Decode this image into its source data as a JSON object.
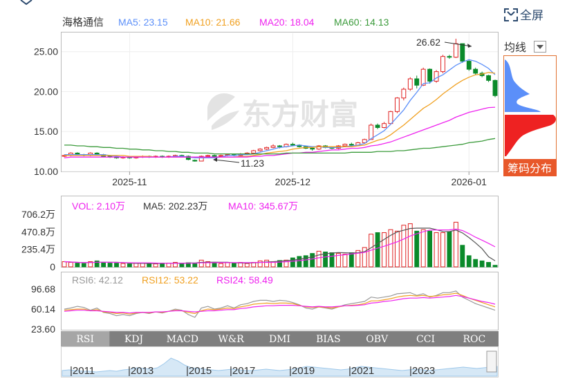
{
  "legend_main": {
    "name": "海格通信",
    "ma5": "MA5: 23.15",
    "ma10": "MA10: 21.66",
    "ma20": "MA20: 18.04",
    "ma60": "MA60: 14.13"
  },
  "legend_vol": {
    "vol": "VOL: 2.10万",
    "ma5": "MA5: 202.23万",
    "ma10": "MA10: 345.67万"
  },
  "legend_rsi": {
    "rsi6": "RSI6: 42.12",
    "rsi12": "RSI12: 53.22",
    "rsi24": "RSI24: 58.49"
  },
  "fullscreen_label": "全屏",
  "junxian_label": "均线",
  "chip_button_label": "筹码分布",
  "watermark": "东方财富",
  "high_annotation": "26.62",
  "low_annotation": "11.23",
  "tabs": [
    "RSI",
    "KDJ",
    "MACD",
    "W&R",
    "DMI",
    "BIAS",
    "OBV",
    "CCI",
    "ROC"
  ],
  "active_tab": "RSI",
  "timeline_labels": [
    "2011",
    "2013",
    "2015",
    "2017",
    "2019",
    "2021",
    "2023"
  ],
  "colors": {
    "up": "#e02020",
    "down": "#0a8a2a",
    "ma5": "#5b8ff9",
    "ma10": "#f0a020",
    "ma20": "#ee22ee",
    "ma60": "#3a9a3a",
    "vol_ma5": "#555555",
    "vol_ma10": "#ee22ee",
    "rsi6": "#999999",
    "rsi12": "#f0a020",
    "rsi24": "#ee22ee"
  },
  "chart_data": [
    {
      "type": "candlestick",
      "title": "",
      "x_tick_labels": [
        "2025-11",
        "2025-12",
        "2026-01"
      ],
      "y_tick_labels": [
        "25.00",
        "20.00",
        "15.00",
        "10.00"
      ],
      "ylim": [
        10,
        27.4
      ],
      "candles": [
        [
          11.9,
          12.0,
          12.1,
          11.8
        ],
        [
          12.0,
          12.3,
          12.4,
          11.9
        ],
        [
          12.3,
          12.1,
          12.4,
          12.0
        ],
        [
          12.1,
          12.0,
          12.2,
          11.9
        ],
        [
          12.0,
          12.3,
          12.4,
          11.9
        ],
        [
          12.3,
          12.1,
          12.4,
          12.0
        ],
        [
          12.1,
          11.9,
          12.2,
          11.8
        ],
        [
          11.9,
          11.8,
          12.0,
          11.7
        ],
        [
          11.8,
          11.7,
          11.9,
          11.6
        ],
        [
          11.7,
          11.8,
          11.9,
          11.6
        ],
        [
          11.8,
          11.7,
          11.9,
          11.6
        ],
        [
          11.7,
          11.8,
          11.9,
          11.6
        ],
        [
          11.8,
          11.9,
          12.0,
          11.7
        ],
        [
          11.9,
          11.8,
          12.0,
          11.7
        ],
        [
          11.8,
          11.9,
          12.0,
          11.7
        ],
        [
          11.9,
          11.8,
          12.0,
          11.7
        ],
        [
          11.8,
          11.9,
          12.0,
          11.7
        ],
        [
          11.9,
          12.0,
          12.1,
          11.8
        ],
        [
          12.0,
          11.9,
          12.1,
          11.8
        ],
        [
          11.9,
          11.5,
          12.0,
          11.4
        ],
        [
          11.4,
          11.3,
          11.5,
          11.23
        ],
        [
          11.3,
          11.9,
          12.0,
          11.3
        ],
        [
          11.9,
          12.0,
          12.1,
          11.8
        ],
        [
          12.0,
          11.9,
          12.1,
          11.8
        ],
        [
          11.9,
          12.0,
          12.1,
          11.8
        ],
        [
          12.0,
          12.1,
          12.2,
          11.9
        ],
        [
          12.1,
          12.0,
          12.2,
          11.9
        ],
        [
          12.0,
          12.2,
          12.3,
          11.9
        ],
        [
          12.2,
          12.3,
          12.4,
          12.1
        ],
        [
          12.3,
          12.6,
          12.7,
          12.2
        ],
        [
          12.6,
          12.8,
          12.9,
          12.5
        ],
        [
          12.8,
          13.0,
          13.1,
          12.7
        ],
        [
          13.0,
          13.2,
          13.4,
          12.9
        ],
        [
          13.2,
          13.1,
          13.3,
          12.9
        ],
        [
          13.1,
          13.4,
          13.5,
          13.0
        ],
        [
          13.4,
          13.3,
          13.6,
          13.2
        ],
        [
          13.3,
          13.1,
          13.4,
          13.0
        ],
        [
          13.1,
          12.9,
          13.2,
          12.8
        ],
        [
          12.9,
          12.8,
          13.0,
          12.6
        ],
        [
          12.8,
          13.2,
          13.3,
          12.7
        ],
        [
          13.2,
          13.0,
          13.3,
          12.9
        ],
        [
          13.0,
          12.9,
          13.1,
          12.8
        ],
        [
          12.9,
          13.2,
          13.3,
          12.8
        ],
        [
          13.2,
          13.4,
          13.5,
          13.1
        ],
        [
          13.4,
          13.3,
          13.6,
          13.2
        ],
        [
          13.3,
          13.6,
          13.7,
          13.2
        ],
        [
          13.6,
          14.0,
          14.1,
          13.5
        ],
        [
          14.0,
          15.8,
          16.0,
          14.0
        ],
        [
          15.8,
          15.5,
          16.0,
          15.3
        ],
        [
          15.5,
          16.0,
          16.2,
          15.4
        ],
        [
          16.0,
          17.5,
          17.6,
          15.9
        ],
        [
          17.5,
          19.2,
          19.3,
          17.3
        ],
        [
          19.2,
          20.3,
          20.5,
          18.9
        ],
        [
          20.3,
          21.6,
          21.8,
          20.1
        ],
        [
          21.6,
          20.8,
          22.0,
          20.4
        ],
        [
          20.8,
          22.8,
          23.0,
          20.7
        ],
        [
          22.8,
          21.3,
          22.9,
          21.0
        ],
        [
          21.3,
          22.5,
          22.7,
          21.1
        ],
        [
          22.5,
          24.4,
          24.6,
          22.3
        ],
        [
          24.4,
          24.3,
          24.6,
          24.1
        ],
        [
          24.3,
          26.0,
          26.62,
          24.2
        ],
        [
          26.0,
          23.8,
          26.0,
          23.6
        ],
        [
          23.8,
          22.8,
          24.0,
          22.6
        ],
        [
          22.8,
          22.3,
          23.0,
          22.1
        ],
        [
          22.3,
          22.0,
          22.5,
          21.8
        ],
        [
          22.0,
          21.4,
          22.1,
          21.2
        ],
        [
          21.4,
          19.5,
          21.5,
          19.3
        ]
      ],
      "series": [
        {
          "name": "MA5",
          "values": [
            12.1,
            12.1,
            12.1,
            12.1,
            12.1,
            12.1,
            12.1,
            12.0,
            11.9,
            11.8,
            11.8,
            11.8,
            11.8,
            11.8,
            11.8,
            11.8,
            11.8,
            11.9,
            11.9,
            11.8,
            11.7,
            11.7,
            11.7,
            11.7,
            11.8,
            12.0,
            12.0,
            12.1,
            12.1,
            12.2,
            12.4,
            12.6,
            12.8,
            13.0,
            13.1,
            13.2,
            13.3,
            13.2,
            13.1,
            13.1,
            13.0,
            13.0,
            13.0,
            13.1,
            13.2,
            13.3,
            13.5,
            14.1,
            14.6,
            15.1,
            15.9,
            16.8,
            17.7,
            18.9,
            19.9,
            21.0,
            21.1,
            21.7,
            22.1,
            22.7,
            23.3,
            23.7,
            24.0,
            23.8,
            23.4,
            22.9,
            22.1
          ]
        },
        {
          "name": "MA10",
          "values": [
            12.0,
            12.0,
            12.0,
            12.0,
            12.0,
            12.0,
            12.0,
            12.0,
            12.0,
            12.0,
            11.9,
            11.9,
            11.9,
            11.9,
            11.8,
            11.8,
            11.8,
            11.8,
            11.8,
            11.8,
            11.8,
            11.8,
            11.8,
            11.8,
            11.8,
            11.8,
            11.8,
            11.9,
            11.9,
            12.0,
            12.1,
            12.3,
            12.4,
            12.5,
            12.6,
            12.8,
            12.9,
            13.0,
            13.0,
            13.1,
            13.1,
            13.1,
            13.1,
            13.1,
            13.1,
            13.2,
            13.3,
            13.6,
            13.9,
            14.1,
            14.6,
            15.2,
            15.8,
            16.5,
            17.2,
            17.9,
            18.4,
            19.0,
            19.7,
            20.3,
            20.9,
            21.4,
            21.8,
            22.1,
            22.2,
            22.4,
            22.3
          ]
        },
        {
          "name": "MA20",
          "values": [
            11.7,
            11.8,
            11.8,
            11.8,
            11.8,
            11.8,
            11.8,
            11.8,
            11.8,
            11.8,
            11.8,
            11.8,
            11.8,
            11.8,
            11.8,
            11.8,
            11.8,
            11.8,
            11.8,
            11.8,
            11.8,
            11.8,
            11.8,
            11.8,
            11.8,
            11.8,
            11.8,
            11.8,
            11.8,
            11.9,
            11.9,
            12.0,
            12.0,
            12.1,
            12.2,
            12.3,
            12.3,
            12.4,
            12.4,
            12.5,
            12.6,
            12.7,
            12.7,
            12.8,
            12.9,
            12.9,
            13.0,
            13.2,
            13.3,
            13.5,
            13.7,
            14.0,
            14.3,
            14.6,
            14.9,
            15.2,
            15.5,
            15.8,
            16.1,
            16.4,
            16.8,
            17.1,
            17.4,
            17.6,
            17.8,
            18.0,
            18.04
          ]
        },
        {
          "name": "MA60",
          "values": [
            13.3,
            13.3,
            13.2,
            13.2,
            13.1,
            13.1,
            13.0,
            13.0,
            12.9,
            12.9,
            12.8,
            12.8,
            12.7,
            12.7,
            12.6,
            12.6,
            12.5,
            12.5,
            12.4,
            12.4,
            12.3,
            12.3,
            12.3,
            12.2,
            12.2,
            12.2,
            12.2,
            12.2,
            12.2,
            12.2,
            12.2,
            12.2,
            12.2,
            12.2,
            12.3,
            12.3,
            12.3,
            12.3,
            12.3,
            12.3,
            12.3,
            12.3,
            12.3,
            12.3,
            12.4,
            12.4,
            12.4,
            12.4,
            12.5,
            12.5,
            12.5,
            12.6,
            12.6,
            12.7,
            12.8,
            12.9,
            12.9,
            13.0,
            13.1,
            13.2,
            13.3,
            13.4,
            13.6,
            13.7,
            13.8,
            14.0,
            14.13
          ]
        }
      ]
    },
    {
      "type": "bar",
      "title": "VOL",
      "y_tick_labels": [
        "706.2万",
        "470.8万",
        "235.4万",
        "0"
      ],
      "ylim": [
        0,
        706.2
      ],
      "unit": "万",
      "values": [
        70,
        60,
        50,
        45,
        70,
        80,
        60,
        50,
        50,
        45,
        40,
        50,
        50,
        45,
        40,
        50,
        50,
        60,
        45,
        55,
        50,
        90,
        70,
        50,
        45,
        55,
        50,
        60,
        45,
        60,
        80,
        90,
        70,
        85,
        90,
        120,
        140,
        150,
        180,
        210,
        200,
        190,
        180,
        170,
        190,
        220,
        260,
        440,
        460,
        460,
        500,
        480,
        560,
        580,
        480,
        500,
        480,
        460,
        460,
        470,
        600,
        290,
        150,
        100,
        80,
        60,
        21
      ]
    },
    {
      "type": "line",
      "title": "RSI",
      "y_tick_labels": [
        "96.68",
        "60.14",
        "23.60"
      ],
      "ylim": [
        23.6,
        96.68
      ],
      "series": [
        {
          "name": "RSI6",
          "values": [
            60,
            62,
            65,
            63,
            58,
            62,
            54,
            52,
            48,
            50,
            48,
            52,
            54,
            52,
            55,
            53,
            56,
            60,
            58,
            50,
            45,
            62,
            65,
            60,
            62,
            66,
            62,
            68,
            70,
            74,
            76,
            76,
            74,
            76,
            75,
            72,
            68,
            62,
            60,
            64,
            62,
            60,
            64,
            68,
            70,
            72,
            74,
            82,
            80,
            82,
            84,
            88,
            89,
            90,
            85,
            88,
            82,
            85,
            90,
            90,
            93,
            82,
            76,
            70,
            66,
            62,
            58
          ]
        },
        {
          "name": "RSI12",
          "values": [
            58,
            59,
            60,
            60,
            57,
            59,
            55,
            54,
            52,
            53,
            51,
            53,
            54,
            53,
            55,
            54,
            56,
            58,
            57,
            54,
            52,
            57,
            60,
            59,
            60,
            62,
            61,
            64,
            66,
            69,
            70,
            71,
            70,
            71,
            71,
            70,
            67,
            64,
            63,
            64,
            63,
            62,
            64,
            66,
            67,
            68,
            70,
            75,
            75,
            77,
            79,
            82,
            84,
            85,
            84,
            85,
            83,
            84,
            86,
            87,
            89,
            85,
            80,
            76,
            72,
            68,
            64
          ]
        },
        {
          "name": "RSI24",
          "values": [
            56,
            57,
            58,
            58,
            57,
            57,
            56,
            55,
            54,
            54,
            53,
            54,
            54,
            54,
            55,
            55,
            56,
            57,
            57,
            56,
            55,
            56,
            57,
            57,
            58,
            59,
            59,
            61,
            62,
            64,
            65,
            66,
            66,
            67,
            67,
            67,
            66,
            65,
            64,
            65,
            64,
            64,
            65,
            66,
            66,
            67,
            68,
            71,
            72,
            74,
            75,
            77,
            79,
            80,
            80,
            81,
            80,
            81,
            82,
            83,
            85,
            83,
            80,
            77,
            74,
            72,
            69
          ]
        }
      ]
    }
  ]
}
